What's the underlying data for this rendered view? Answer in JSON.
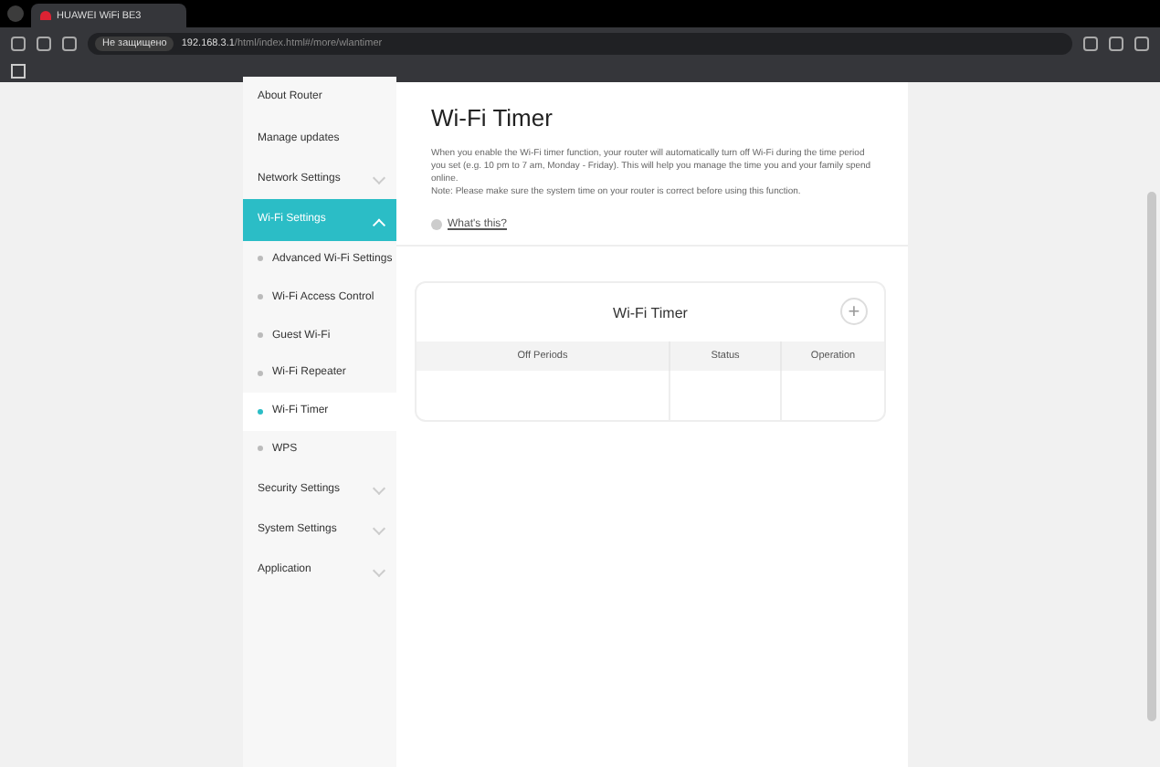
{
  "browser": {
    "tab_title": "HUAWEI WiFi BE3",
    "security": "Не защищено",
    "url_host": "192.168.3.1",
    "url_path": "/html/index.html#/more/wlantimer"
  },
  "sidebar": {
    "items": [
      {
        "label": "About Router",
        "selected": false
      },
      {
        "label": "Manage updates",
        "selected": false
      },
      {
        "label": "Network Settings",
        "expanded": false,
        "selected": false
      },
      {
        "label": "Wi-Fi Settings",
        "expanded": true,
        "selected": true,
        "children": [
          {
            "label": "Advanced Wi-Fi Settings",
            "selected": false
          },
          {
            "label": "Wi-Fi Access Control",
            "selected": false
          },
          {
            "label": "Guest Wi-Fi",
            "selected": false
          },
          {
            "label": "Wi-Fi Repeater",
            "selected": false
          },
          {
            "label": "Wi-Fi Timer",
            "selected": true
          },
          {
            "label": "WPS",
            "selected": false
          }
        ]
      },
      {
        "label": "Security Settings",
        "expanded": false,
        "selected": false
      },
      {
        "label": "System Settings",
        "expanded": false,
        "selected": false
      },
      {
        "label": "Application",
        "expanded": false,
        "selected": false
      }
    ]
  },
  "main": {
    "title": "Wi-Fi Timer",
    "description": "When you enable the Wi-Fi timer function, your router will automatically turn off Wi-Fi during the time period you set (e.g. 10 pm to 7 am, Monday - Friday). This will help you manage the time you and your family spend online.",
    "note": "Note: Please make sure the system time on your router is correct before using this function.",
    "help_link": "What's this?",
    "card": {
      "title": "Wi-Fi Timer",
      "add_button": "+",
      "columns": [
        "Off Periods",
        "Status",
        "Operation"
      ]
    }
  }
}
